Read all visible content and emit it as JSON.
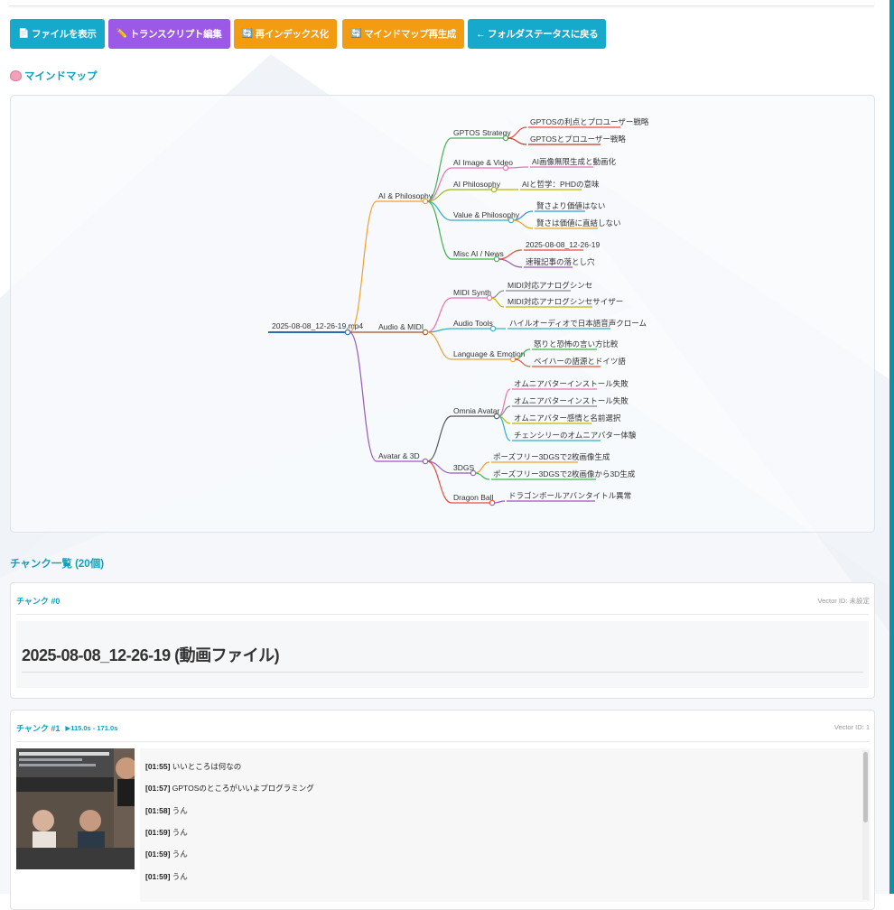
{
  "toolbar": {
    "buttons": [
      {
        "icon": "document-icon",
        "label": "ファイルを表示",
        "color": "#17a9cc"
      },
      {
        "icon": "pencil-icon",
        "label": "トランスクリプト編集",
        "color": "#9b59e6"
      },
      {
        "icon": "refresh-icon",
        "label": "再インデックス化",
        "color": "#f39c12"
      },
      {
        "icon": "refresh-icon",
        "label": "マインドマップ再生成",
        "color": "#f39c12"
      },
      {
        "icon": "back-arrow",
        "label": "← フォルダステータスに戻る",
        "color": "#17a9cc"
      }
    ]
  },
  "mindmap": {
    "title": "マインドマップ",
    "root": "2025-08-08_12-26-19.mp4",
    "branches": [
      {
        "label": "AI & Philosophy",
        "color": "#f0a030",
        "children": [
          {
            "label": "GPTOS Strategy",
            "color": "#3fb34f",
            "leaves": [
              "GPTOSの利点とプロユーザー戦略",
              "GPTOSとプロユーザー戦略"
            ],
            "leaf_colors": [
              "#e74c3c",
              "#c0392b"
            ]
          },
          {
            "label": "AI Image & Video",
            "color": "#e673b5",
            "leaves": [
              "AI画像無限生成と動画化"
            ],
            "leaf_colors": [
              "#e673b5"
            ]
          },
          {
            "label": "AI Philosophy",
            "color": "#9ab520",
            "leaves": [
              "AIと哲学：PHDの意味"
            ],
            "leaf_colors": [
              "#c8b400"
            ]
          },
          {
            "label": "Value & Philosophy",
            "color": "#2fb0c8",
            "leaves": [
              "賢さより価値はない",
              "賢さは価値に直結しない"
            ],
            "leaf_colors": [
              "#3498db",
              "#f0a030"
            ]
          },
          {
            "label": "Misc AI / News",
            "color": "#3fb34f",
            "leaves": [
              "2025-08-08_12-26-19",
              "速報記事の落とし穴"
            ],
            "leaf_colors": [
              "#e74c3c",
              "#9b59b6"
            ]
          }
        ]
      },
      {
        "label": "Audio & MIDI",
        "color": "#a0522d",
        "children": [
          {
            "label": "MIDI Synth",
            "color": "#e673b5",
            "leaves": [
              "MIDI対応アナログシンセ",
              "MIDI対応アナログシンセサイザー"
            ],
            "leaf_colors": [
              "#888888",
              "#c8b400"
            ]
          },
          {
            "label": "Audio Tools",
            "color": "#2fb0c8",
            "leaves": [
              "ハイルオーディオで日本語音声クローム"
            ],
            "leaf_colors": [
              "#2fb0c8"
            ]
          },
          {
            "label": "Language & Emotion",
            "color": "#f0a030",
            "leaves": [
              "怒りと恐怖の言い方比較",
              "ベイハーの語源とドイツ語"
            ],
            "leaf_colors": [
              "#3fb34f",
              "#e74c3c"
            ]
          }
        ]
      },
      {
        "label": "Avatar & 3D",
        "color": "#9b59b6",
        "children": [
          {
            "label": "Omnia Avatar",
            "color": "#555555",
            "leaves": [
              "オムニアバターインストール失敗",
              "オムニアバターインストール失敗",
              "オムニアバター感情と名前選択",
              "チェンシリーのオムニアバター体験"
            ],
            "leaf_colors": [
              "#e673b5",
              "#888888",
              "#c8b400",
              "#2fb0c8"
            ]
          },
          {
            "label": "3DGS",
            "color": "#9b59b6",
            "leaves": [
              "ポーズフリー3DGSで2枚画像生成",
              "ポーズフリー3DGSで2枚画像から3D生成"
            ],
            "leaf_colors": [
              "#f0a030",
              "#3fb34f"
            ]
          },
          {
            "label": "Dragon Ball",
            "color": "#e74c3c",
            "leaves": [
              "ドラゴンボールアバンタイトル異常"
            ],
            "leaf_colors": [
              "#9b59b6"
            ]
          }
        ]
      }
    ]
  },
  "chunks": {
    "title": "チャンク一覧 (20個)",
    "items": [
      {
        "label": "チャンク #0",
        "vector_id": "Vector ID: 未設定",
        "doc_title": "2025-08-08_12-26-19 (動画ファイル)"
      },
      {
        "label": "チャンク #1",
        "time": "▶115.0s - 171.0s",
        "vector_id": "Vector ID: 1",
        "lines": [
          {
            "ts": "[01:55]",
            "text": "いいところは何なの"
          },
          {
            "ts": "[01:57]",
            "text": "GPTOSのところがいいよプログラミング"
          },
          {
            "ts": "[01:58]",
            "text": "うん"
          },
          {
            "ts": "[01:59]",
            "text": "うん"
          },
          {
            "ts": "[01:59]",
            "text": "うん"
          },
          {
            "ts": "[01:59]",
            "text": "うん"
          }
        ]
      }
    ]
  },
  "colors": {
    "accent": "#10a0bd",
    "teal_button": "#17a9cc",
    "purple_button": "#9b59e6",
    "orange_button": "#f39c12"
  }
}
